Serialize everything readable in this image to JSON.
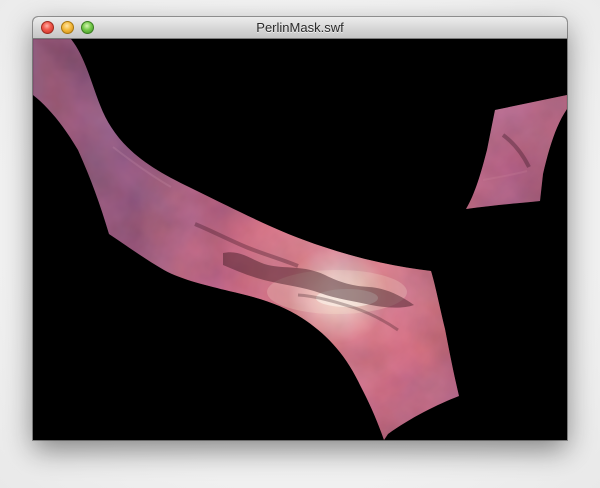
{
  "window": {
    "title": "PerlinMask.swf"
  },
  "icons": {
    "close": "close-icon",
    "minimize": "minimize-icon",
    "maximize": "maximize-icon"
  },
  "colors": {
    "canvas_background": "#000000",
    "galaxy_core": "#f4d3b4",
    "galaxy_mid": "#b84a57",
    "galaxy_edge": "#6f2e52"
  }
}
